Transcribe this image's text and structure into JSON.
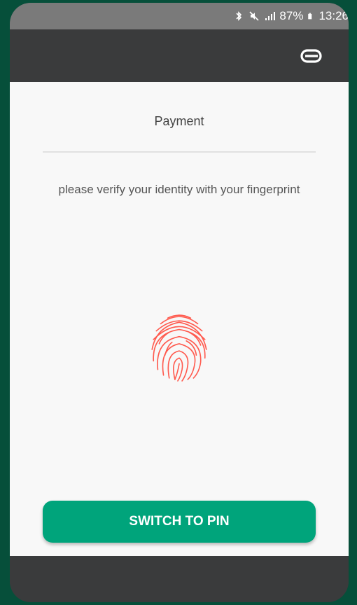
{
  "status_bar": {
    "battery": "87%",
    "time": "13:26",
    "icons": [
      "bluetooth-icon",
      "mute-icon",
      "signal-icon",
      "battery-icon"
    ]
  },
  "app_bar": {
    "logo_icon": "link-logo-icon"
  },
  "main": {
    "title": "Payment",
    "message": "please verify your identity with your fingerprint",
    "fingerprint_icon": "fingerprint-icon",
    "fingerprint_color": "#ff5a4e"
  },
  "actions": {
    "switch_to_pin_label": "SWITCH TO PIN"
  },
  "colors": {
    "accent": "#00a47b",
    "background": "#064f3a",
    "app_bar": "#3a3b3c"
  }
}
